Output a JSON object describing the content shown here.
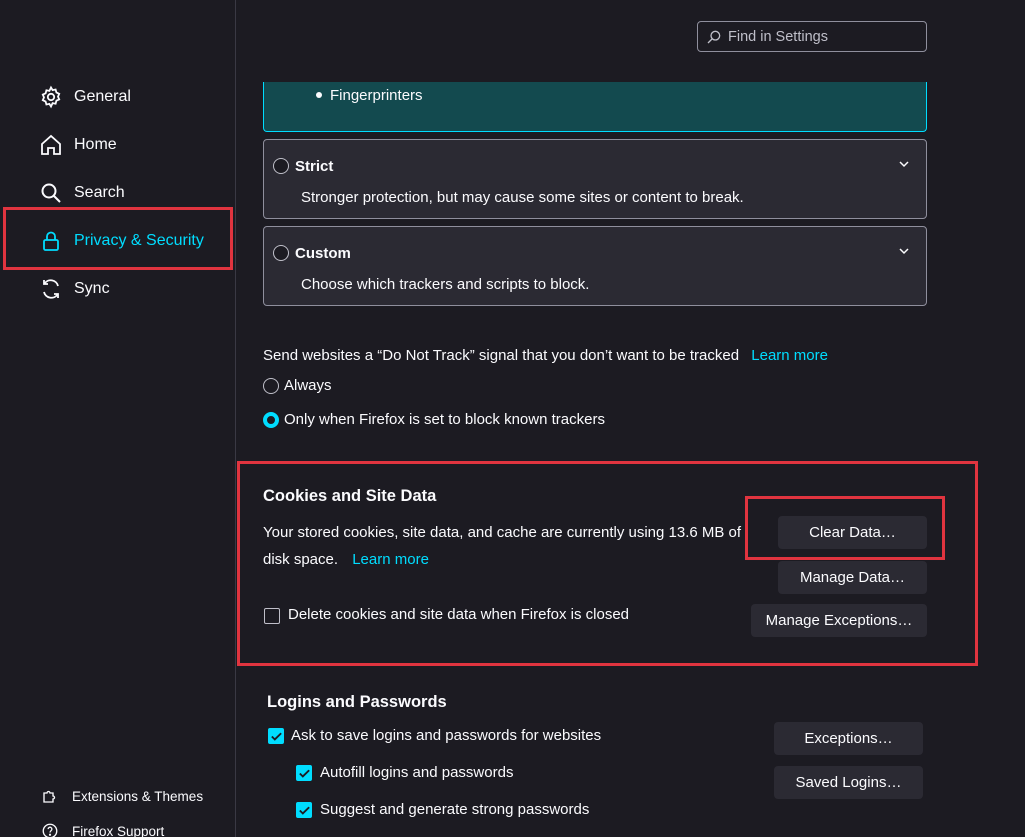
{
  "colors": {
    "accent": "#00ddff",
    "highlight": "#e0343f",
    "background": "#1c1b22",
    "surface": "#2b2a33"
  },
  "search": {
    "placeholder": "Find in Settings",
    "icon": "search-icon"
  },
  "sidebar": {
    "items": [
      {
        "label": "General",
        "icon": "gear-icon"
      },
      {
        "label": "Home",
        "icon": "home-icon"
      },
      {
        "label": "Search",
        "icon": "search-icon"
      },
      {
        "label": "Privacy & Security",
        "icon": "lock-icon",
        "selected": true
      },
      {
        "label": "Sync",
        "icon": "sync-icon"
      }
    ],
    "footer": [
      {
        "label": "Extensions & Themes",
        "icon": "puzzle-icon"
      },
      {
        "label": "Firefox Support",
        "icon": "help-icon"
      }
    ]
  },
  "tracking": {
    "standard_bullet": "Fingerprinters",
    "strict": {
      "title": "Strict",
      "desc": "Stronger protection, but may cause some sites or content to break."
    },
    "custom": {
      "title": "Custom",
      "desc": "Choose which trackers and scripts to block."
    }
  },
  "dnt": {
    "label": "Send websites a “Do Not Track” signal that you don’t want to be tracked",
    "learn_more": "Learn more",
    "options": [
      "Always",
      "Only when Firefox is set to block known trackers"
    ],
    "selected": 1
  },
  "cookies": {
    "heading": "Cookies and Site Data",
    "usage_line1": "Your stored cookies, site data, and cache are currently using 13.6 MB of",
    "usage_line2": "disk space.",
    "learn_more": "Learn more",
    "delete_on_close": "Delete cookies and site data when Firefox is closed",
    "delete_on_close_checked": false,
    "buttons": {
      "clear": "Clear Data…",
      "manage": "Manage Data…",
      "exceptions": "Manage Exceptions…"
    }
  },
  "logins": {
    "heading": "Logins and Passwords",
    "ask_to_save": "Ask to save logins and passwords for websites",
    "autofill": "Autofill logins and passwords",
    "suggest": "Suggest and generate strong passwords",
    "buttons": {
      "exceptions": "Exceptions…",
      "saved": "Saved Logins…"
    }
  }
}
